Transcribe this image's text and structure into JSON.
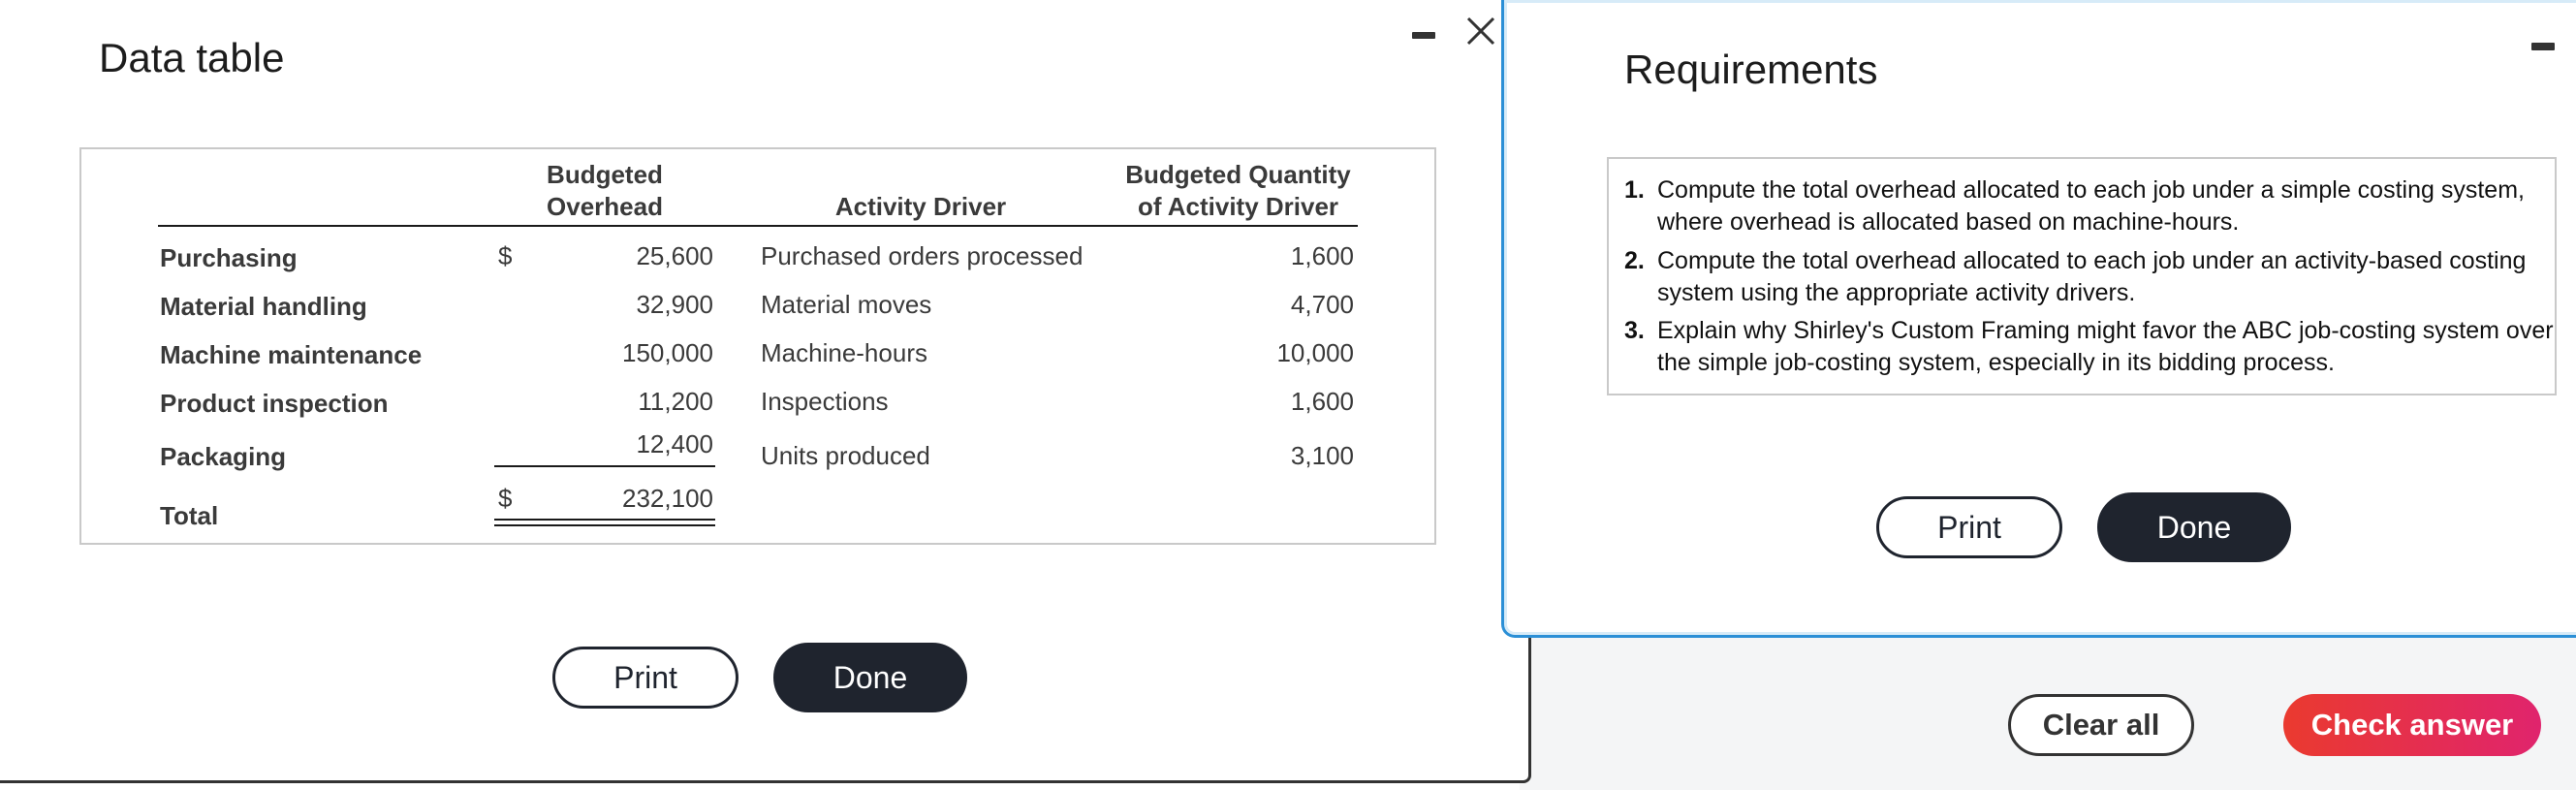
{
  "data_dialog": {
    "title": "Data table",
    "headers": {
      "budgeted_overhead": [
        "Budgeted",
        "Overhead"
      ],
      "activity_driver": "Activity Driver",
      "budgeted_quantity": [
        "Budgeted Quantity",
        "of Activity Driver"
      ]
    },
    "rows": [
      {
        "label": "Purchasing",
        "currency": "$",
        "overhead": "25,600",
        "driver": "Purchased orders processed",
        "quantity": "1,600"
      },
      {
        "label": "Material handling",
        "currency": "",
        "overhead": "32,900",
        "driver": "Material moves",
        "quantity": "4,700"
      },
      {
        "label": "Machine maintenance",
        "currency": "",
        "overhead": "150,000",
        "driver": "Machine-hours",
        "quantity": "10,000"
      },
      {
        "label": "Product inspection",
        "currency": "",
        "overhead": "11,200",
        "driver": "Inspections",
        "quantity": "1,600"
      },
      {
        "label": "Packaging",
        "currency": "",
        "overhead": "12,400",
        "driver": "Units produced",
        "quantity": "3,100"
      }
    ],
    "total": {
      "label": "Total",
      "currency": "$",
      "overhead": "232,100"
    },
    "print_label": "Print",
    "done_label": "Done"
  },
  "requirements_dialog": {
    "title": "Requirements",
    "items": [
      {
        "num": "1.",
        "text": "Compute the total overhead allocated to each job under a simple costing system, where overhead is allocated based on machine-hours."
      },
      {
        "num": "2.",
        "text": "Compute the total overhead allocated to each job under an activity-based costing system using the appropriate activity drivers."
      },
      {
        "num": "3.",
        "text": "Explain why Shirley's Custom Framing might favor the ABC job-costing system over the simple job-costing system, especially in its bidding process."
      }
    ],
    "print_label": "Print",
    "done_label": "Done"
  },
  "footer": {
    "clear_all_label": "Clear all",
    "check_answer_label": "Check answer"
  },
  "colors": {
    "dark_button": "#1f242e",
    "accent_border": "#2b8fd6",
    "check_answer_start": "#ea3a2f",
    "check_answer_end": "#e0246d"
  },
  "icons": [
    "minimize-icon",
    "close-icon"
  ]
}
